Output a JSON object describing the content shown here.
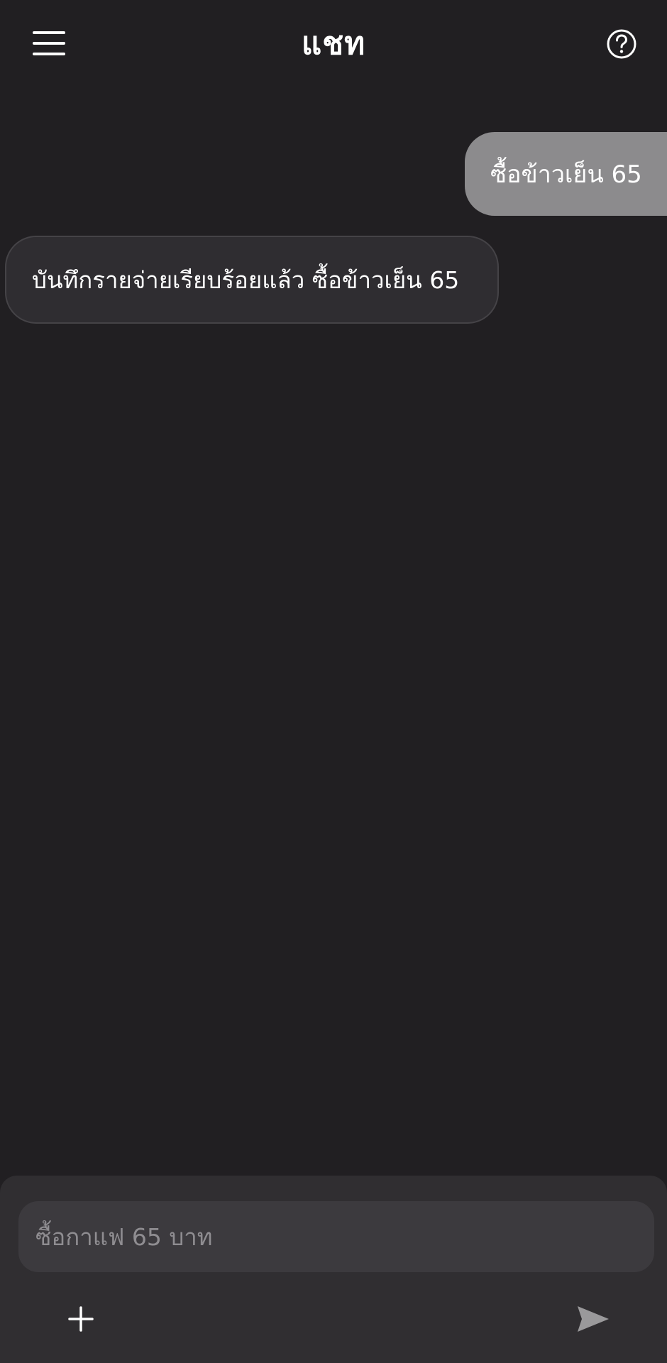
{
  "header": {
    "title": "แชท",
    "menu_icon": "hamburger-menu-icon",
    "help_icon": "question-circle-icon"
  },
  "messages": [
    {
      "role": "user",
      "text": "ซื้อข้าวเย็น 65"
    },
    {
      "role": "assistant",
      "text": "บันทึกรายจ่ายเรียบร้อยแล้ว ซื้อข้าวเย็น 65"
    }
  ],
  "composer": {
    "placeholder": "ซื้อกาแฟ 65 บาท",
    "value": "",
    "add_icon": "plus-icon",
    "send_icon": "send-icon"
  },
  "colors": {
    "background": "#211f22",
    "user_bubble": "#8c8b8d",
    "assistant_bubble": "#2f2d31",
    "composer": "#302e31",
    "input": "#3c3a3e",
    "send_icon": "#9a999b"
  }
}
